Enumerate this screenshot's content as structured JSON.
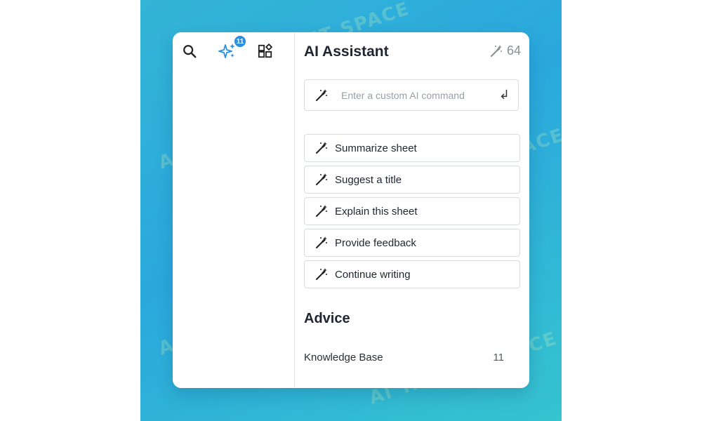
{
  "watermark": "AI TALENT SPACE",
  "rail": {
    "notification_count": "11",
    "icons": [
      "search-icon",
      "sparkles-icon",
      "apps-icon"
    ]
  },
  "assistant": {
    "title": "AI Assistant",
    "credits": "64",
    "command": {
      "placeholder": "Enter a custom AI command",
      "value": ""
    },
    "actions": [
      {
        "label": "Summarize sheet"
      },
      {
        "label": "Suggest a title"
      },
      {
        "label": "Explain this sheet"
      },
      {
        "label": "Provide feedback"
      },
      {
        "label": "Continue writing"
      }
    ]
  },
  "advice": {
    "title": "Advice",
    "items": [
      {
        "label": "Knowledge Base",
        "count": "11"
      }
    ]
  },
  "colors": {
    "accent": "#2a8fde",
    "background_gradient": [
      "#33b5d6",
      "#2aa8dd",
      "#36c4cf"
    ]
  }
}
